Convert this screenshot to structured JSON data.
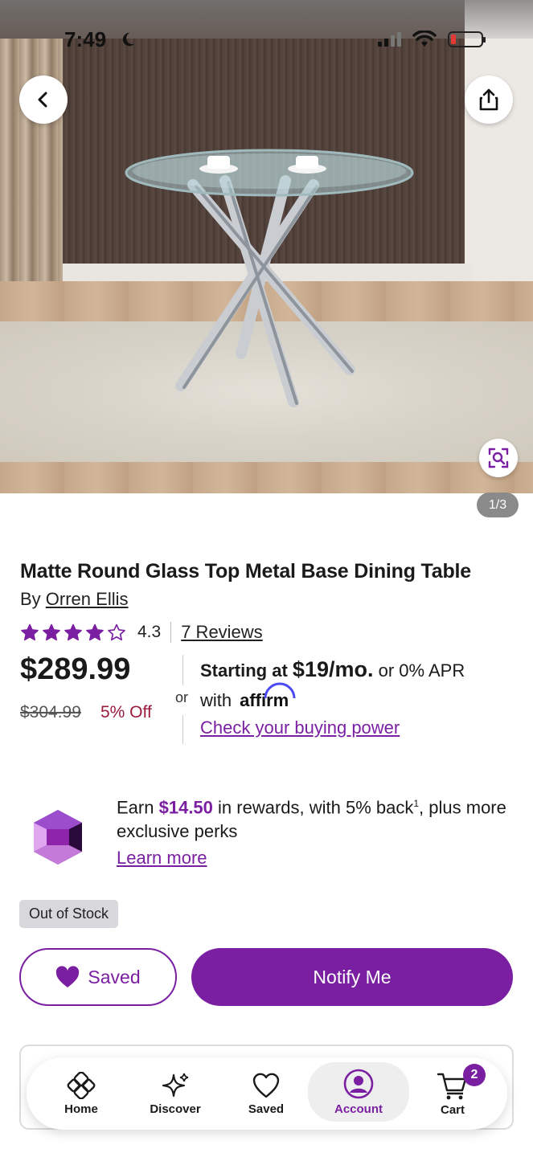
{
  "status_bar": {
    "time": "7:49"
  },
  "gallery": {
    "counter": "1/3"
  },
  "product": {
    "title": "Matte Round Glass Top Metal Base Dining Table",
    "by_prefix": "By ",
    "brand": "Orren Ellis",
    "rating": "4.3",
    "rating_fraction": 0.86,
    "reviews_link": "7 Reviews",
    "price": "$289.99",
    "was_price": "$304.99",
    "discount": "5% Off",
    "or_label": "or"
  },
  "financing": {
    "starting_at": "Starting at",
    "monthly": "$19/mo.",
    "apr_text": "or 0% APR",
    "with": "with",
    "provider": "affirm",
    "check_link": "Check your buying power"
  },
  "rewards": {
    "earn": "Earn",
    "amount": "$14.50",
    "text1": "in rewards, with 5% back",
    "footnote": "1",
    "text2": ", plus more exclusive perks",
    "learn_more": "Learn more"
  },
  "stock_badge": "Out of Stock",
  "actions": {
    "saved_label": "Saved",
    "notify_label": "Notify Me"
  },
  "tabbar": {
    "home": "Home",
    "discover": "Discover",
    "saved": "Saved",
    "account": "Account",
    "cart": "Cart",
    "cart_count": "2"
  },
  "colors": {
    "brand_purple": "#7b1fa2",
    "sale_red": "#9b1b3a"
  }
}
